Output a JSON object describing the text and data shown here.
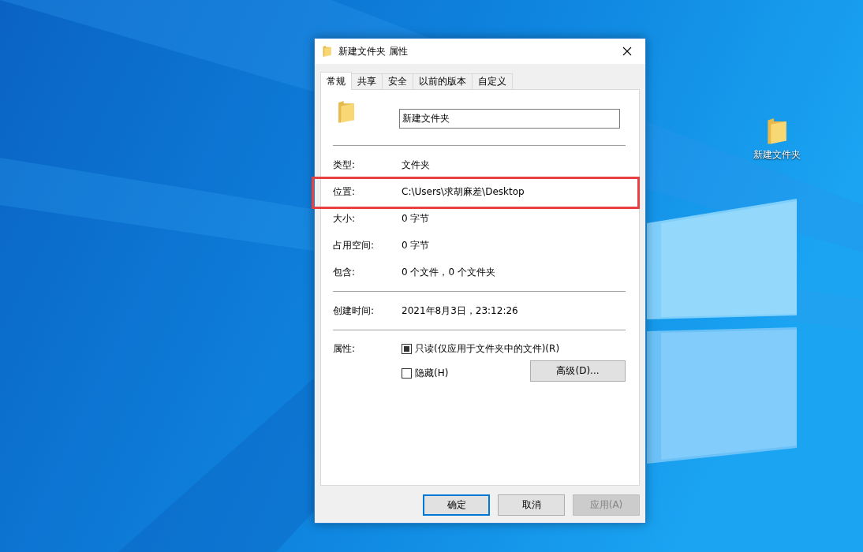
{
  "desktop": {
    "icons": [
      {
        "label": "新建文件夹"
      }
    ]
  },
  "dialog": {
    "title": "新建文件夹 属性",
    "tabs": [
      {
        "label": "常规",
        "selected": true
      },
      {
        "label": "共享",
        "selected": false
      },
      {
        "label": "安全",
        "selected": false
      },
      {
        "label": "以前的版本",
        "selected": false
      },
      {
        "label": "自定义",
        "selected": false
      }
    ],
    "name_field": {
      "value": "新建文件夹"
    },
    "sections": [
      [
        {
          "label": "类型:",
          "value": "文件夹",
          "highlighted": false
        },
        {
          "label": "位置:",
          "value": "C:\\Users\\求胡麻差\\Desktop",
          "highlighted": true
        },
        {
          "label": "大小:",
          "value": "0 字节",
          "highlighted": false
        },
        {
          "label": "占用空间:",
          "value": "0 字节",
          "highlighted": false
        },
        {
          "label": "包含:",
          "value": "0 个文件，0 个文件夹",
          "highlighted": false
        }
      ],
      [
        {
          "label": "创建时间:",
          "value": "2021年8月3日，23:12:26",
          "highlighted": false
        }
      ]
    ],
    "attributes": {
      "label": "属性:",
      "checkboxes": [
        {
          "label": "只读(仅应用于文件夹中的文件)(R)",
          "checked": false,
          "indeterminate": true
        },
        {
          "label": "隐藏(H)",
          "checked": false,
          "indeterminate": false
        }
      ],
      "advanced_button": "高级(D)..."
    },
    "buttons": [
      {
        "label": "确定",
        "default": true,
        "disabled": false
      },
      {
        "label": "取消",
        "default": false,
        "disabled": false
      },
      {
        "label": "应用(A)",
        "default": false,
        "disabled": true
      }
    ]
  }
}
